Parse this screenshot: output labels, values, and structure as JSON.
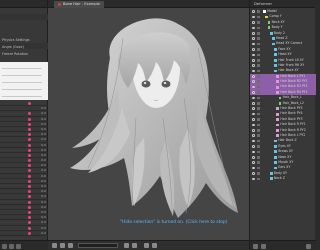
{
  "viewport": {
    "tab_title": "Bone Hair - Example",
    "hide_notice": "\"Hide selection\" is turned on. (Click here to stop)"
  },
  "left_panel": {
    "labels": [
      "Physics Settings",
      "Angle (Gaze)",
      "Freeze Rotation"
    ]
  },
  "deformers": {
    "title": "Deformer",
    "items": [
      {
        "label": "Model",
        "indent": 1,
        "color": "#ffffff",
        "style": ""
      },
      {
        "label": "Comp Y",
        "indent": 2,
        "color": "#e8d24a",
        "style": ""
      },
      {
        "label": "Neck XY",
        "indent": 3,
        "color": "#7ad06a",
        "style": ""
      },
      {
        "label": "Body Y",
        "indent": 3,
        "color": "#7ad06a",
        "style": ""
      },
      {
        "label": "Body 2",
        "indent": 4,
        "color": "#6cc0e0",
        "style": ""
      },
      {
        "label": "Head Z",
        "indent": 5,
        "color": "#6cc0e0",
        "style": ""
      },
      {
        "label": "Head XY Correct",
        "indent": 5,
        "color": "#6cc0e0",
        "style": ""
      },
      {
        "label": "Face XY",
        "indent": 6,
        "color": "#6cc0e0",
        "style": ""
      },
      {
        "label": "Head XY",
        "indent": 6,
        "color": "#6cc0e0",
        "style": ""
      },
      {
        "label": "Hair Front L6 XY",
        "indent": 6,
        "color": "#6cc0e0",
        "style": ""
      },
      {
        "label": "Hair Front R6 XY",
        "indent": 6,
        "color": "#6cc0e0",
        "style": ""
      },
      {
        "label": "Hair Back XY",
        "indent": 6,
        "color": "#6cc0e0",
        "style": ""
      },
      {
        "label": "Hair Back L PY1",
        "indent": 7,
        "color": "#d89ad8",
        "style": "sel"
      },
      {
        "label": "Hair Back R2 PY1",
        "indent": 7,
        "color": "#d89ad8",
        "style": "sel"
      },
      {
        "label": "Hair Back R3 PY1",
        "indent": 7,
        "color": "#d89ad8",
        "style": "sel"
      },
      {
        "label": "Hair Back R4 PY1",
        "indent": 7,
        "color": "#d89ad8",
        "style": "sel"
      },
      {
        "label": "Hair_Back_L",
        "indent": 8,
        "color": "#7ad06a",
        "style": ""
      },
      {
        "label": "Hair_Back_L2",
        "indent": 8,
        "color": "#7ad06a",
        "style": ""
      },
      {
        "label": "Hair Back PY5",
        "indent": 7,
        "color": "#d89ad8",
        "style": ""
      },
      {
        "label": "Hair Back PY4",
        "indent": 7,
        "color": "#d89ad8",
        "style": ""
      },
      {
        "label": "Hair Back PY3",
        "indent": 7,
        "color": "#d89ad8",
        "style": ""
      },
      {
        "label": "Hair Back R PY1",
        "indent": 7,
        "color": "#d89ad8",
        "style": ""
      },
      {
        "label": "Hair Back R PY2",
        "indent": 7,
        "color": "#d89ad8",
        "style": ""
      },
      {
        "label": "Hair Back L PY2",
        "indent": 7,
        "color": "#d89ad8",
        "style": ""
      },
      {
        "label": "Hair Back Z",
        "indent": 6,
        "color": "#6cc0e0",
        "style": ""
      },
      {
        "label": "Eyes XY",
        "indent": 6,
        "color": "#6cc0e0",
        "style": ""
      },
      {
        "label": "Brows XY",
        "indent": 6,
        "color": "#6cc0e0",
        "style": ""
      },
      {
        "label": "Nose XY",
        "indent": 6,
        "color": "#6cc0e0",
        "style": ""
      },
      {
        "label": "Mouth XY",
        "indent": 6,
        "color": "#6cc0e0",
        "style": ""
      },
      {
        "label": "Ears XY",
        "indent": 6,
        "color": "#6cc0e0",
        "style": ""
      },
      {
        "label": "Body XY",
        "indent": 4,
        "color": "#6cc0e0",
        "style": ""
      },
      {
        "label": "Neck Z",
        "indent": 4,
        "color": "#6cc0e0",
        "style": ""
      }
    ]
  },
  "timeline": {
    "rows": [
      {
        "label": "",
        "key": true,
        "value": ""
      },
      {
        "label": "",
        "key": false,
        "value": "0.0"
      },
      {
        "label": "",
        "key": true,
        "value": "0.0"
      },
      {
        "label": "",
        "key": true,
        "value": "0.0"
      },
      {
        "label": "",
        "key": true,
        "value": "0.0"
      },
      {
        "label": "",
        "key": true,
        "value": "0.0"
      },
      {
        "label": "",
        "key": true,
        "value": "0.0"
      },
      {
        "label": "",
        "key": true,
        "value": "0.0"
      },
      {
        "label": "",
        "key": true,
        "value": "0.0"
      },
      {
        "label": "",
        "key": true,
        "value": "0.0"
      },
      {
        "label": "",
        "key": true,
        "value": "0.0"
      },
      {
        "label": "",
        "key": true,
        "value": "0.0"
      },
      {
        "label": "",
        "key": true,
        "value": "0.0"
      },
      {
        "label": "",
        "key": true,
        "value": "0.0"
      },
      {
        "label": "",
        "key": true,
        "value": "0.0"
      },
      {
        "label": "",
        "key": true,
        "value": "0.0"
      },
      {
        "label": "",
        "key": true,
        "value": "0.0"
      },
      {
        "label": "",
        "key": true,
        "value": "0.0"
      },
      {
        "label": "",
        "key": true,
        "value": "0.0"
      },
      {
        "label": "",
        "key": true,
        "value": "0.0"
      },
      {
        "label": "",
        "key": true,
        "value": "0.0"
      },
      {
        "label": "",
        "key": true,
        "value": "0.0"
      },
      {
        "label": "",
        "key": true,
        "value": "0.0"
      },
      {
        "label": "",
        "key": true,
        "value": "0.0"
      },
      {
        "label": "",
        "key": true,
        "value": "0.0"
      },
      {
        "label": "",
        "key": true,
        "value": "0.0"
      }
    ]
  },
  "icons": {
    "eye": "eye-icon",
    "lock": "lock-icon",
    "keyframe": "keyframe-icon"
  },
  "colors": {
    "notice": "#5ab8ff",
    "selection": "#8e5fa8",
    "keyframe": "#e04a78"
  }
}
